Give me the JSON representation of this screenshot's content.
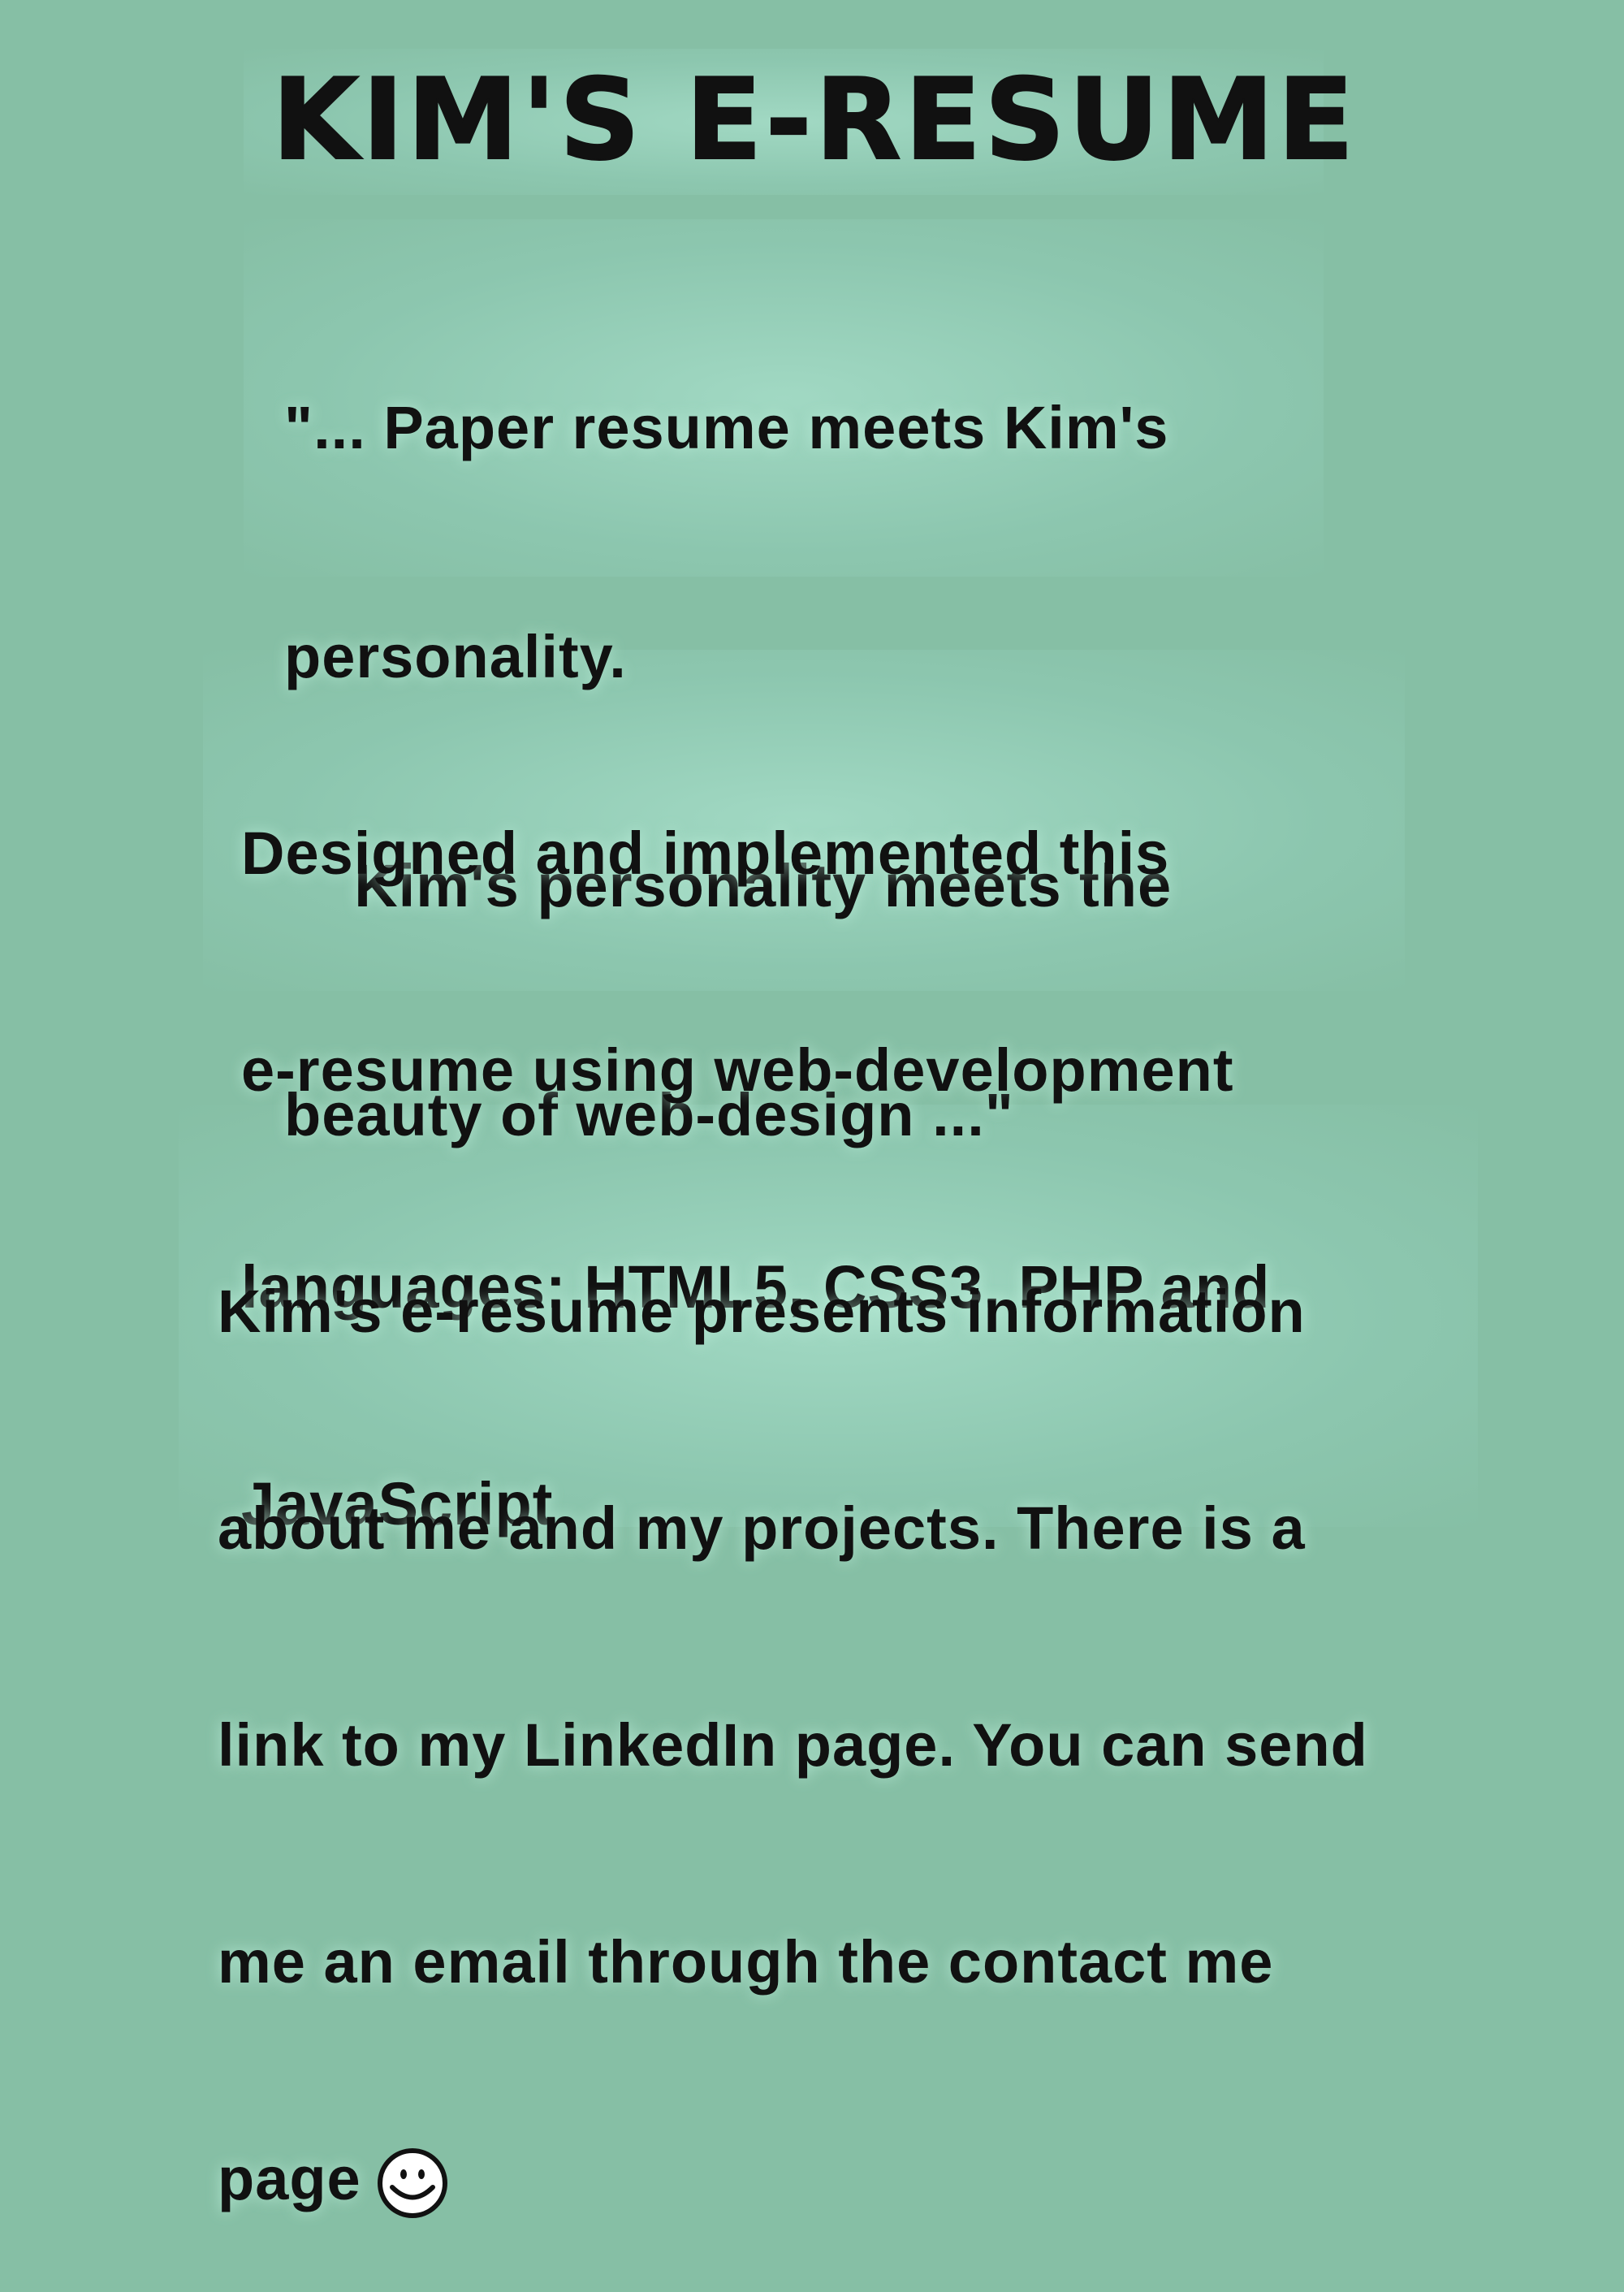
{
  "title": "KIM'S E-RESUME",
  "quote": {
    "lines": [
      "\"... Paper resume meets Kim's",
      "personality.",
      "    Kim's personality meets the",
      "beauty of web-design ...\""
    ]
  },
  "description": {
    "lines": [
      "Designed and implemented this",
      "e-resume using web-development",
      "languages: HTML5, CSS3, PHP and",
      "JavaScript"
    ]
  },
  "about": {
    "lines": [
      "Kim's e-resume presents information",
      "about me and my projects. There is a",
      "link to my LinkedIn page. You can send",
      "me an email through the contact me",
      "page"
    ]
  },
  "icons": {
    "smiley": "smiley-face-icon"
  },
  "colors": {
    "background": "#86bfa5",
    "text": "#111111"
  }
}
